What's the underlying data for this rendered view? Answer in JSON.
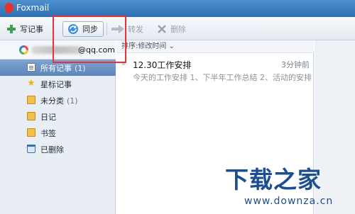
{
  "window": {
    "title": "Foxmail"
  },
  "toolbar": {
    "write_label": "写记事",
    "sync_label": "同步",
    "forward_label": "转发",
    "delete_label": "删除"
  },
  "sidebar": {
    "account_suffix": "@qq.com",
    "items": [
      {
        "label": "所有记事",
        "count": "(1)"
      },
      {
        "label": "星标记事",
        "count": ""
      },
      {
        "label": "未分类",
        "count": "(1)"
      },
      {
        "label": "日记",
        "count": ""
      },
      {
        "label": "书签",
        "count": ""
      },
      {
        "label": "已删除",
        "count": ""
      }
    ]
  },
  "list": {
    "sort_label": "排序:修改时间 ⌄",
    "notes": [
      {
        "title": "12.30工作安排",
        "time": "3分钟前",
        "preview": "今天的工作安排 1、下半年工作总结 2、活动的安排"
      }
    ]
  },
  "watermark": {
    "title": "下载之家",
    "url": "www.downza.cn"
  },
  "icons": [
    "app-logo-icon",
    "add-icon",
    "sync-icon",
    "forward-icon",
    "delete-icon",
    "account-icon",
    "notes-icon",
    "star-icon",
    "folder-icon",
    "trash-icon"
  ],
  "colors": {
    "titlebar": "#2f6fb2",
    "selected": "#5d86bc",
    "highlight_box": "#e8313a",
    "watermark": "#1b4f91"
  }
}
